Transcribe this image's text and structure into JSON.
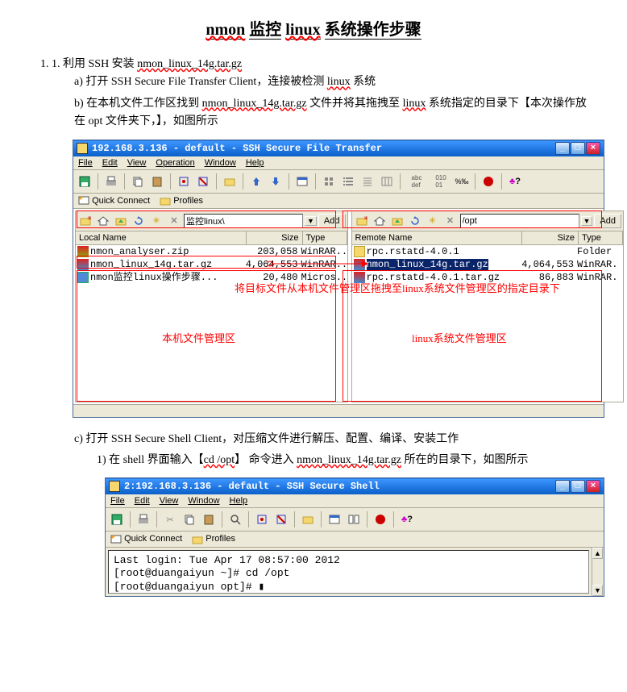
{
  "doc": {
    "title_parts": [
      "nmon",
      "监控",
      "linux",
      "系统操作步骤"
    ],
    "item1": {
      "num": "1.",
      "text_prefix": "利用 SSH 安装 ",
      "file": "nmon_linux_14g.tar.gz",
      "a_prefix": "a)   打开 SSH Secure File Transfer Client，连接被检测 ",
      "a_linux": "linux",
      "a_suffix": " 系统",
      "b_prefix": "b)   在本机文件工作区找到 ",
      "b_file": "nmon_linux_14g.tar.gz",
      "b_mid": " 文件并将其拖拽至 ",
      "b_linux": "linux",
      "b_suffix": " 系统指定的目录下【本次操作放在 opt 文件夹下，】，如图所示",
      "c_text": "c)   打开 SSH Secure Shell Client，对压缩文件进行解压、配置、编译、安装工作",
      "c1_prefix": "1)   在 shell 界面输入【",
      "c1_cmd": "cd /opt",
      "c1_mid": "】 命令进入 ",
      "c1_file": "nmon_linux_14g.tar.gz",
      "c1_suffix": " 所在的目录下，如图所示"
    }
  },
  "ft_win": {
    "title": "192.168.3.136 - default - SSH Secure File Transfer",
    "menu": [
      "File",
      "Edit",
      "View",
      "Operation",
      "Window",
      "Help"
    ],
    "quick_connect": "Quick Connect",
    "profiles": "Profiles",
    "local": {
      "path": "监控linux\\",
      "add": "Add",
      "headers": [
        "Local Name",
        "Size",
        "Type"
      ],
      "files": [
        {
          "name": "nmon_analyser.zip",
          "size": "203,058",
          "type": "WinRAR..",
          "icon": "zip"
        },
        {
          "name": "nmon_linux_14g.tar.gz",
          "size": "4,064,553",
          "type": "WinRAR..",
          "icon": "gz"
        },
        {
          "name": "nmon监控linux操作步骤...",
          "size": "20,480",
          "type": "Micros..",
          "icon": "doc"
        }
      ]
    },
    "remote": {
      "path": "/opt",
      "add": "Add",
      "headers": [
        "Remote Name",
        "Size",
        "Type"
      ],
      "files": [
        {
          "name": "rpc.rstatd-4.0.1",
          "size": "",
          "type": "Folder",
          "icon": "folder"
        },
        {
          "name": "nmon_linux_14g.tar.gz",
          "size": "4,064,553",
          "type": "WinRAR.",
          "icon": "gz",
          "sel": true
        },
        {
          "name": "rpc.rstatd-4.0.1.tar.gz",
          "size": "86,883",
          "type": "WinRAR.",
          "icon": "gz"
        }
      ]
    },
    "annotations": {
      "drag_note": "将目标文件从本机文件管理区拖拽至linux系统文件管理区的指定目录下",
      "local_area": "本机文件管理区",
      "remote_area": "linux系统文件管理区"
    }
  },
  "sh_win": {
    "title": "2:192.168.3.136 - default - SSH Secure Shell",
    "menu": [
      "File",
      "Edit",
      "View",
      "Window",
      "Help"
    ],
    "quick_connect": "Quick Connect",
    "profiles": "Profiles",
    "lines": [
      "Last login: Tue Apr 17 08:57:00 2012",
      "[root@duangaiyun ~]# cd /opt",
      "[root@duangaiyun opt]# "
    ]
  },
  "colors": {
    "titlebar": "#0a5fc9",
    "frame": "#ece9d8",
    "red": "#f00"
  }
}
